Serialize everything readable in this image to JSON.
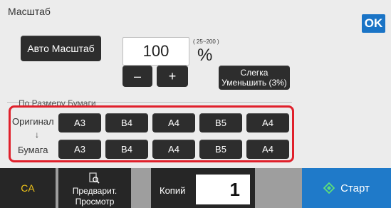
{
  "header": {
    "title": "Масштаб",
    "ok_label": "OK"
  },
  "scale": {
    "auto_label": "Авто Масштаб",
    "value": "100",
    "range": "( 25~200 )",
    "unit": "%",
    "minus_label": "–",
    "plus_label": "+",
    "reduce_label": "Слегка Уменьшить (3%)"
  },
  "paper_section": {
    "title": "По Размеру Бумаги",
    "original_label": "Оригинал",
    "arrow": "↓",
    "paper_label": "Бумага",
    "original_sizes": [
      "A3",
      "B4",
      "A4",
      "B5",
      "A4"
    ],
    "paper_sizes": [
      "A3",
      "B4",
      "A4",
      "B5",
      "A4"
    ],
    "highlight_color": "#e0202b"
  },
  "bottom_bar": {
    "ca_label": "CA",
    "preview_label": "Предварит. Просмотр",
    "copies_label": "Копий",
    "copies_value": "1",
    "start_label": "Старт"
  },
  "colors": {
    "accent": "#1f7ac9",
    "ca_text": "#f0c419",
    "button_dark": "#2d2d2d"
  }
}
